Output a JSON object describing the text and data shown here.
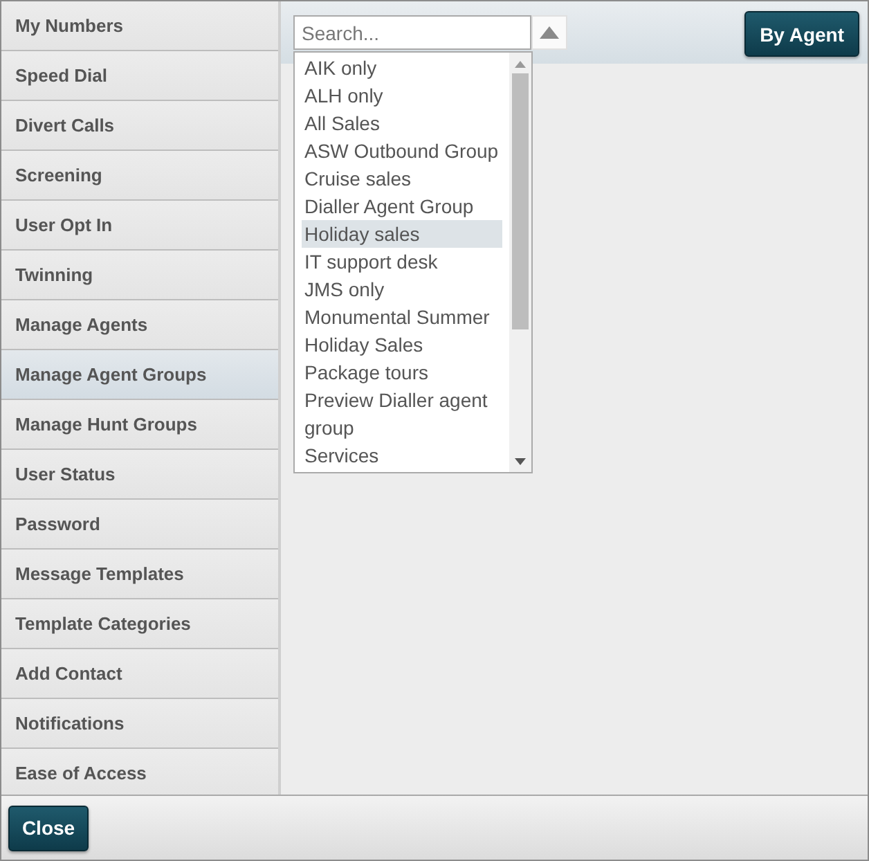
{
  "sidebar": {
    "items": [
      {
        "label": "My Numbers",
        "selected": false
      },
      {
        "label": "Speed Dial",
        "selected": false
      },
      {
        "label": "Divert Calls",
        "selected": false
      },
      {
        "label": "Screening",
        "selected": false
      },
      {
        "label": "User Opt In",
        "selected": false
      },
      {
        "label": "Twinning",
        "selected": false
      },
      {
        "label": "Manage Agents",
        "selected": false
      },
      {
        "label": "Manage Agent Groups",
        "selected": true
      },
      {
        "label": "Manage Hunt Groups",
        "selected": false
      },
      {
        "label": "User Status",
        "selected": false
      },
      {
        "label": "Password",
        "selected": false
      },
      {
        "label": "Message Templates",
        "selected": false
      },
      {
        "label": "Template Categories",
        "selected": false
      },
      {
        "label": "Add Contact",
        "selected": false
      },
      {
        "label": "Notifications",
        "selected": false
      },
      {
        "label": "Ease of Access",
        "selected": false
      }
    ]
  },
  "dropdown": {
    "search": {
      "placeholder": "Search..."
    },
    "expanded": true,
    "options": [
      {
        "label": "AIK only",
        "selected": false
      },
      {
        "label": "ALH only",
        "selected": false
      },
      {
        "label": "All Sales",
        "selected": false
      },
      {
        "label": "ASW Outbound Group",
        "selected": false
      },
      {
        "label": "Cruise sales",
        "selected": false
      },
      {
        "label": "Dialler Agent Group",
        "selected": false
      },
      {
        "label": "Holiday sales",
        "selected": true
      },
      {
        "label": "IT support desk",
        "selected": false
      },
      {
        "label": "JMS only",
        "selected": false
      },
      {
        "label": "Monumental Summer Holiday Sales",
        "selected": false
      },
      {
        "label": "Package tours",
        "selected": false
      },
      {
        "label": "Preview Dialler agent group",
        "selected": false
      },
      {
        "label": "Services",
        "selected": false
      }
    ]
  },
  "by_agent_button": "By Agent",
  "close_button": "Close"
}
